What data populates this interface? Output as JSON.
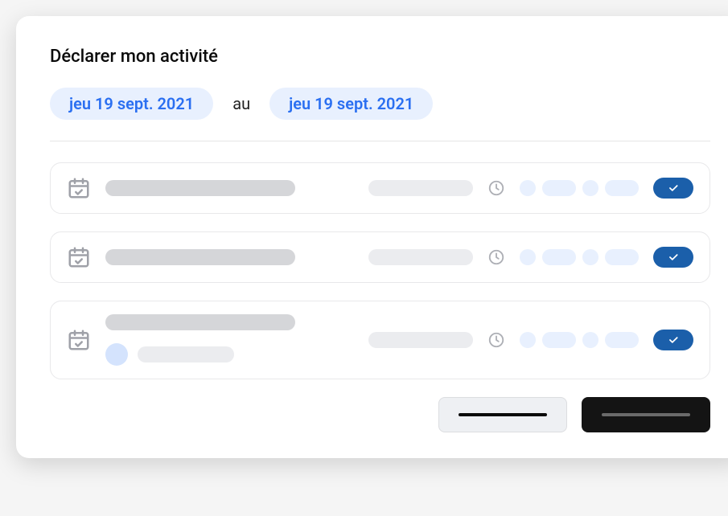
{
  "header": {
    "title": "Déclarer mon activité",
    "date_from": "jeu 19  sept. 2021",
    "date_sep": "au",
    "date_to": "jeu 19  sept. 2021"
  },
  "icons": {
    "calendar": "calendar-check-icon",
    "clock": "clock-icon",
    "check": "check-icon"
  },
  "rows": [
    {
      "has_detail": false
    },
    {
      "has_detail": false
    },
    {
      "has_detail": true
    }
  ],
  "footer": {
    "secondary_label": "",
    "primary_label": ""
  }
}
